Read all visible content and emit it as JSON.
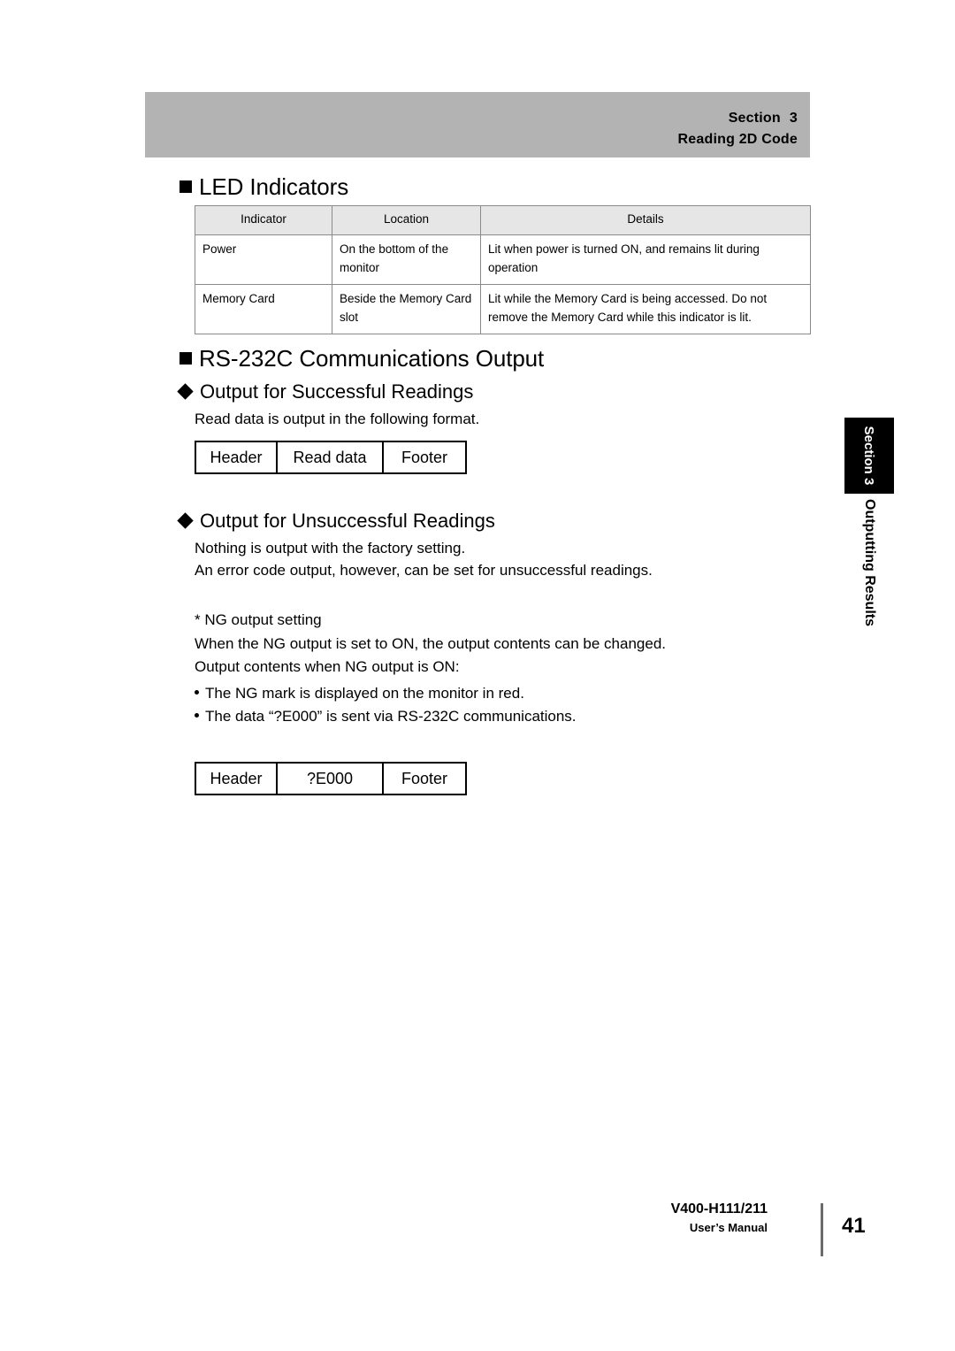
{
  "page_header": {
    "section_label": "Section",
    "section_number": "3",
    "chapter_title": "Reading 2D Code",
    "band_color": "#b3b3b3"
  },
  "sections": {
    "led_indicators": {
      "heading": "LED Indicators",
      "table": {
        "columns": [
          "Indicator",
          "Location",
          "Details"
        ],
        "rows": [
          {
            "indicator": "Power",
            "location_line1": "On the bottom of the",
            "location_line2": "monitor",
            "details_line1": "Lit when power is turned ON, and remains lit during",
            "details_line2": "operation"
          },
          {
            "indicator": "Memory Card",
            "location_line1": "Beside the Memory Card",
            "location_line2": "slot",
            "details_line1": "Lit while the Memory Card is being accessed. Do not",
            "details_line2": "remove the Memory Card while this indicator is lit."
          }
        ]
      }
    },
    "rs232c": {
      "heading": "RS-232C Communications Output",
      "successful": {
        "heading": "Output for Successful Readings",
        "intro": "Read data is output in the following format.",
        "format_box": [
          "Header",
          "Read data",
          "Footer"
        ]
      },
      "unsuccessful": {
        "heading": "Output for Unsuccessful Readings",
        "line1": "Nothing is output with the factory setting.",
        "line2": "An error code output, however, can be set for unsuccessful readings.",
        "note_title": "* NG output setting",
        "line3": "When the NG output is set to ON, the output contents can be changed.",
        "line4": "Output contents when NG output is ON:",
        "bullets": [
          "The NG mark is displayed on the monitor in red.",
          "The data “?E000” is sent via RS-232C communications."
        ],
        "format_box": [
          "Header",
          "?E000",
          "Footer"
        ]
      }
    }
  },
  "side_tab": {
    "box_text": "Section 3",
    "sub_text": "Outputting Results"
  },
  "footer": {
    "model": "V400-H111/211",
    "manual": "User’s Manual",
    "page_number": "41"
  }
}
